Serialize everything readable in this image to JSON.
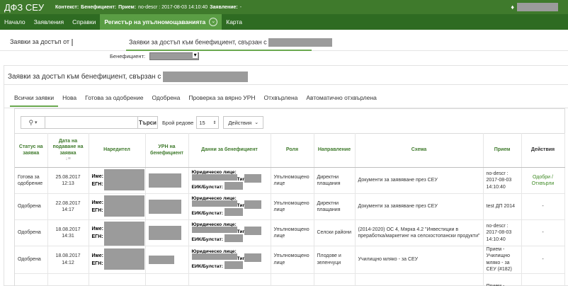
{
  "app": {
    "brand": "ДФЗ СЕУ",
    "context_label": "Контекст:",
    "beneficiary_label": "Бенефициент:",
    "intake_label": "Прием:",
    "intake_value": "no-descr : 2017-08-03 14:10:40",
    "application_label": "Заявление:",
    "application_value": "-"
  },
  "nav": {
    "items": [
      "Начало",
      "Заявления",
      "Справки",
      "Регистър на упълномощаванията",
      "Карта"
    ]
  },
  "subtabs": {
    "left_label": "Заявки за достъп от",
    "right_label": "Заявки за достъп към бенефициент, свързан с"
  },
  "filter": {
    "label": "Бенефициент:"
  },
  "panel": {
    "title": "Заявки за достъп към бенефициент, свързан с"
  },
  "filter_tabs": [
    "Всички заявки",
    "Нова",
    "Готова за одобрение",
    "Одобрена",
    "Проверка за вярно УРН",
    "Отхвърлена",
    "Автоматично отхвърлена"
  ],
  "toolbar": {
    "search_button": "Търси",
    "rows_label": "Брой редове",
    "rows_value": "15",
    "actions_label": "Действия"
  },
  "table": {
    "headers": {
      "status": "Статус на заявка",
      "date": "Дата на подаване на заявка",
      "requester": "Наредител",
      "urn": "УРН на бенефициент",
      "beneficiary_data": "Данни за бенефициент",
      "role": "Роля",
      "direction": "Направление",
      "scheme": "Схема",
      "intake": "Прием",
      "actions": "Действия"
    },
    "name_label": "Име:",
    "egn_label": "ЕГН:",
    "legal_label": "Юридическо лице:",
    "type_label": "Тип:",
    "eik_label": "ЕИК/Булстат:",
    "rows": [
      {
        "status": "Готова за одобрение",
        "date": "25.08.2017",
        "time": "12:13",
        "role": "Упълномощено лице",
        "direction": "Директни плащания",
        "scheme": "Документи за заявяване през СЕУ",
        "intake": "no-descr : 2017-08-03 14:10:40",
        "action_approve": "Одобри",
        "action_sep": " /",
        "action_reject": "Отхвърли"
      },
      {
        "status": "Одобрена",
        "date": "22.08.2017",
        "time": "14:17",
        "role": "Упълномощено лице",
        "direction": "Директни плащания",
        "scheme": "Документи за заявяване през СЕУ",
        "intake": "test ДП 2014",
        "action": "-"
      },
      {
        "status": "Одобрена",
        "date": "18.08.2017",
        "time": "14:31",
        "role": "Упълномощено лице",
        "direction": "Селски райони",
        "scheme": "(2014-2020) ОС 4, Мярка 4.2 \"Инвестиции в преработка/маркетинг на селскостопански продукти\"",
        "intake": "no-descr : 2017-08-03 14:10:40",
        "action": "-"
      },
      {
        "status": "Одобрена",
        "date": "18.08.2017",
        "time": "14:12",
        "role": "Упълномощено лице",
        "direction": "Плодове и зеленчуци",
        "scheme": "Училищно мляко - за СЕУ",
        "intake": "Прием - Училищно мляко - за СЕУ (#182)",
        "action": "-"
      },
      {
        "status": "",
        "date": "",
        "time": "",
        "role": "",
        "direction": "",
        "scheme": "",
        "intake": "Прием -",
        "action": ""
      }
    ]
  }
}
